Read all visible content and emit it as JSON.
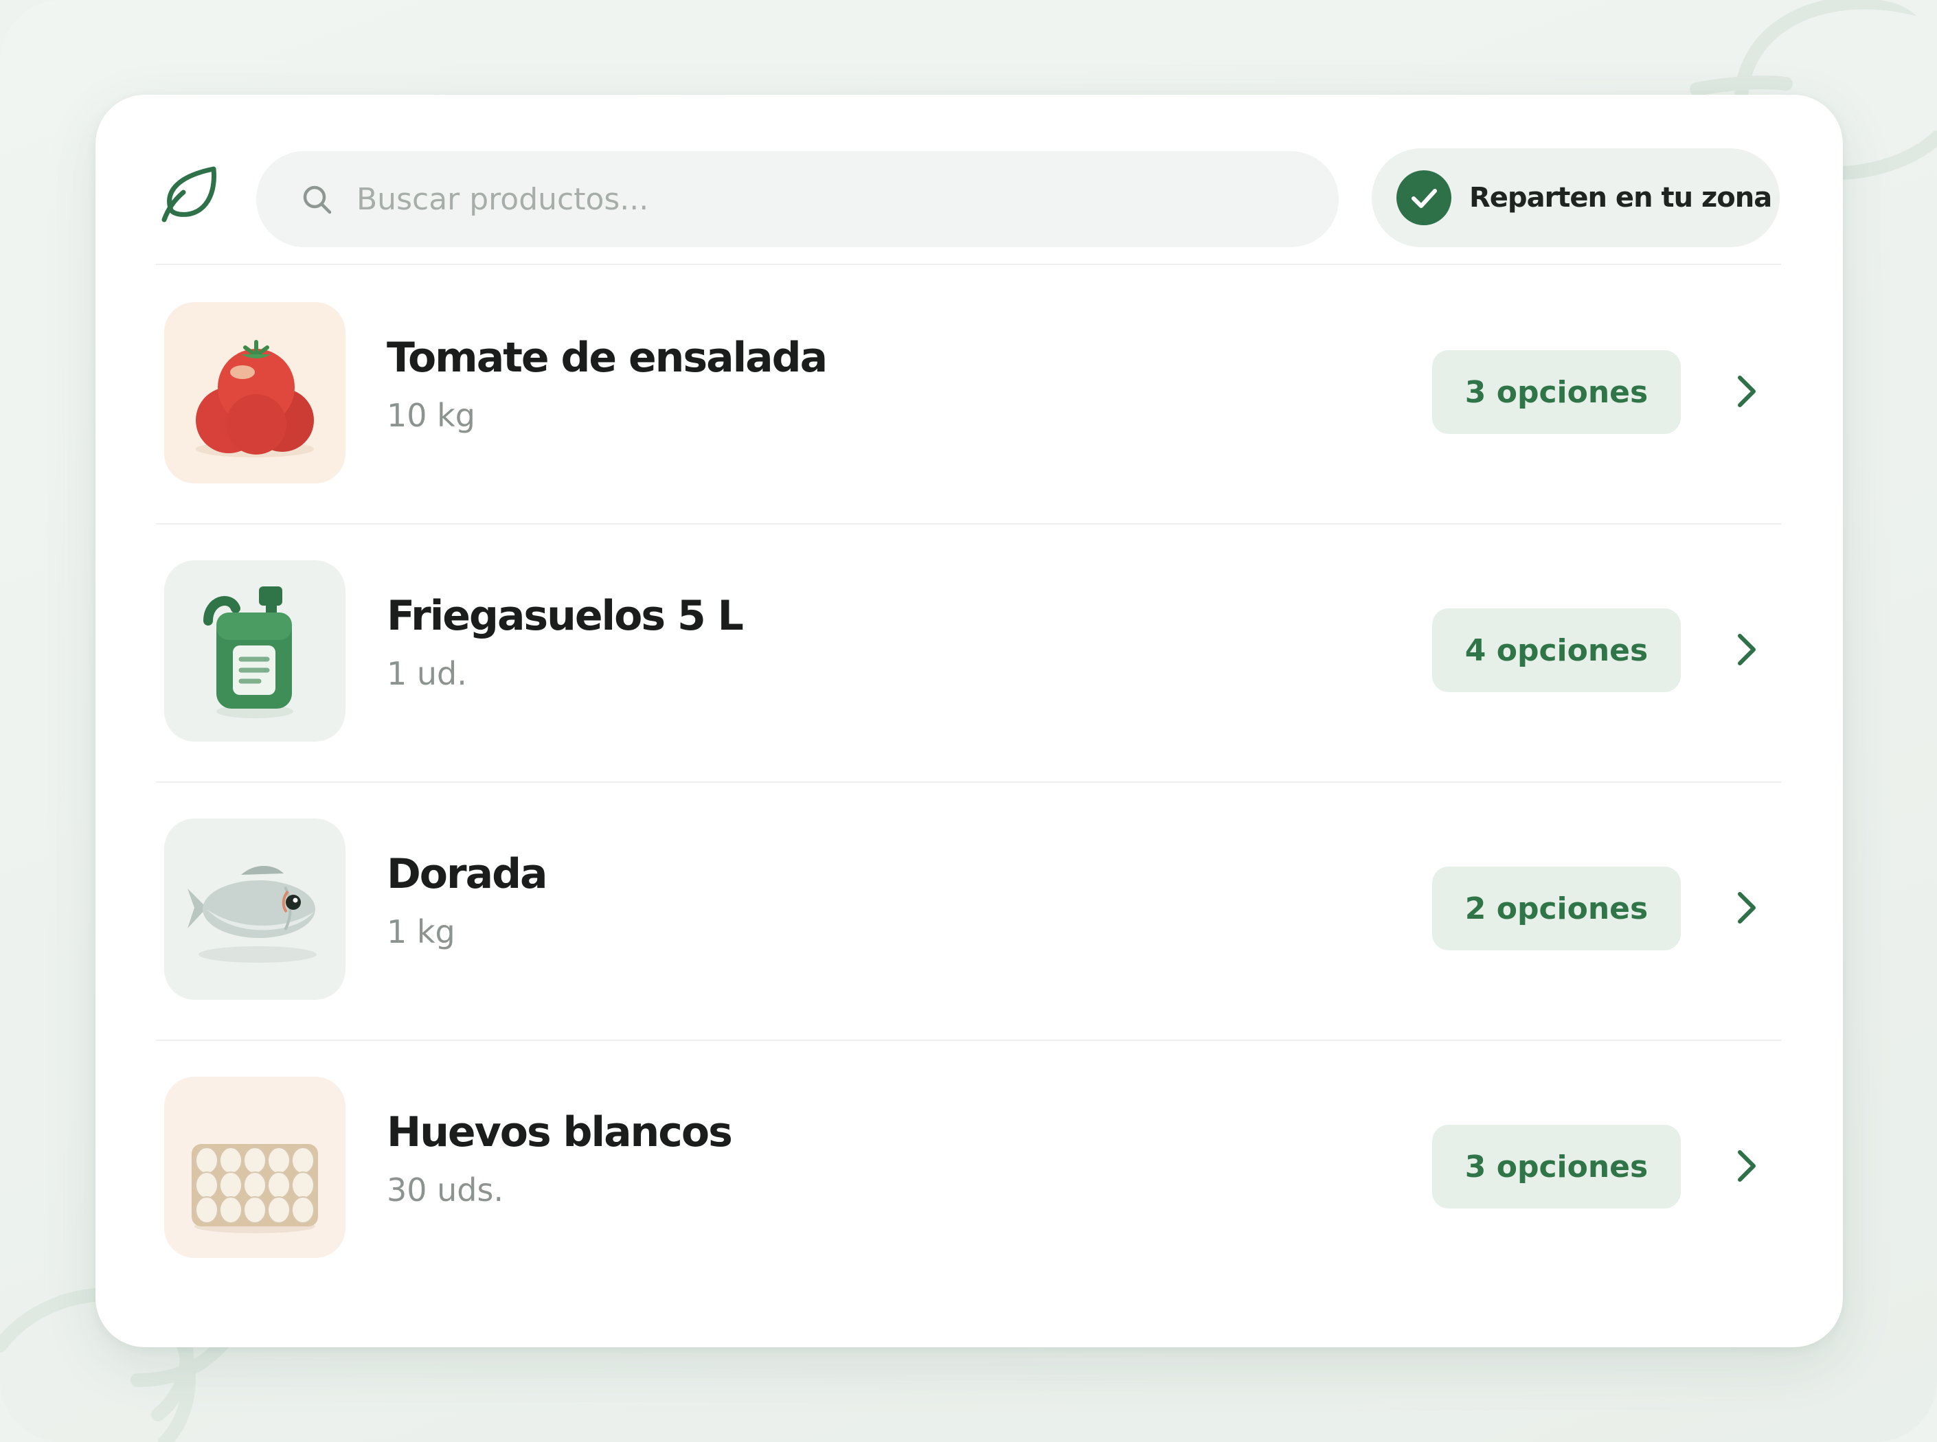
{
  "colors": {
    "accent": "#2e7148",
    "accent_text": "#2f7548",
    "pill_bg": "#e6efe8",
    "card_bg": "#ffffff",
    "page_bg": "#eef3ef"
  },
  "header": {
    "logo_icon": "leaf-icon",
    "search": {
      "placeholder": "Buscar productos...",
      "icon": "search-icon"
    },
    "zone_badge": {
      "icon": "check-circle-icon",
      "label": "Reparten en tu zona"
    }
  },
  "products": [
    {
      "name": "Tomate de ensalada",
      "quantity": "10 kg",
      "options_label": "3 opciones",
      "icon": "tomato-icon"
    },
    {
      "name": "Friegasuelos 5 L",
      "quantity": "1 ud.",
      "options_label": "4 opciones",
      "icon": "detergent-bottle-icon"
    },
    {
      "name": "Dorada",
      "quantity": "1 kg",
      "options_label": "2 opciones",
      "icon": "fish-icon"
    },
    {
      "name": "Huevos blancos",
      "quantity": "30 uds.",
      "options_label": "3 opciones",
      "icon": "egg-carton-icon"
    }
  ]
}
